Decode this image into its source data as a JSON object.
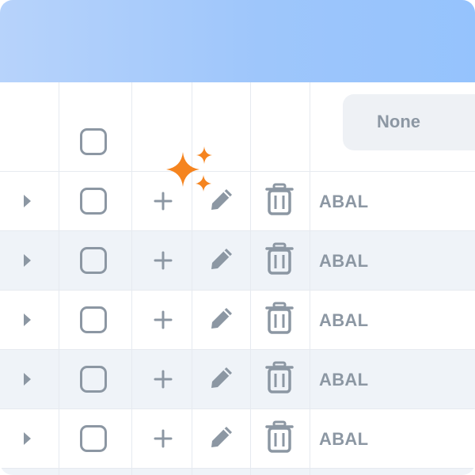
{
  "table": {
    "filter": {
      "value": "None"
    },
    "rows": [
      {
        "code": "ABAL"
      },
      {
        "code": "ABAL"
      },
      {
        "code": "ABAL"
      },
      {
        "code": "ABAL"
      },
      {
        "code": "ABAL"
      }
    ]
  },
  "icons": {
    "expand": "chevron-right-icon",
    "add": "plus-icon",
    "edit": "pencil-icon",
    "delete": "trash-icon",
    "highlight": "sparkle-icon"
  },
  "colors": {
    "banner_gradient_start": "#b7d3fb",
    "banner_gradient_end": "#95c3fd",
    "icon_gray": "#8c97a3",
    "row_stripe": "#eff3f8",
    "sparkle": "#f5841f"
  }
}
